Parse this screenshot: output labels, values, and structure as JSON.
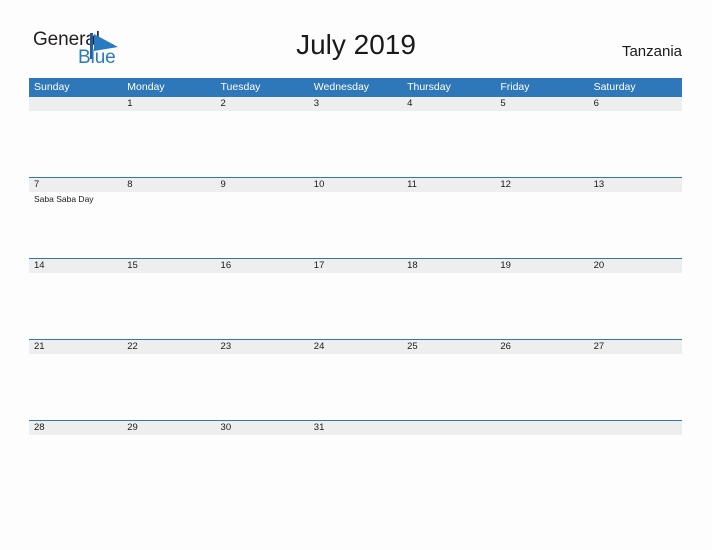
{
  "brand": {
    "name_part1": "General",
    "name_part2": "Blue",
    "mark": "flag-triangle-icon",
    "accent_color": "#2a7ac0"
  },
  "header": {
    "title": "July 2019",
    "region": "Tanzania"
  },
  "calendar": {
    "header_color": "#2e77b8",
    "band_color": "#eeeeee",
    "weekdays": [
      "Sunday",
      "Monday",
      "Tuesday",
      "Wednesday",
      "Thursday",
      "Friday",
      "Saturday"
    ],
    "weeks": [
      {
        "days": [
          {
            "date": "",
            "events": []
          },
          {
            "date": "1",
            "events": []
          },
          {
            "date": "2",
            "events": []
          },
          {
            "date": "3",
            "events": []
          },
          {
            "date": "4",
            "events": []
          },
          {
            "date": "5",
            "events": []
          },
          {
            "date": "6",
            "events": []
          }
        ]
      },
      {
        "days": [
          {
            "date": "7",
            "events": [
              "Saba Saba Day"
            ]
          },
          {
            "date": "8",
            "events": []
          },
          {
            "date": "9",
            "events": []
          },
          {
            "date": "10",
            "events": []
          },
          {
            "date": "11",
            "events": []
          },
          {
            "date": "12",
            "events": []
          },
          {
            "date": "13",
            "events": []
          }
        ]
      },
      {
        "days": [
          {
            "date": "14",
            "events": []
          },
          {
            "date": "15",
            "events": []
          },
          {
            "date": "16",
            "events": []
          },
          {
            "date": "17",
            "events": []
          },
          {
            "date": "18",
            "events": []
          },
          {
            "date": "19",
            "events": []
          },
          {
            "date": "20",
            "events": []
          }
        ]
      },
      {
        "days": [
          {
            "date": "21",
            "events": []
          },
          {
            "date": "22",
            "events": []
          },
          {
            "date": "23",
            "events": []
          },
          {
            "date": "24",
            "events": []
          },
          {
            "date": "25",
            "events": []
          },
          {
            "date": "26",
            "events": []
          },
          {
            "date": "27",
            "events": []
          }
        ]
      },
      {
        "days": [
          {
            "date": "28",
            "events": []
          },
          {
            "date": "29",
            "events": []
          },
          {
            "date": "30",
            "events": []
          },
          {
            "date": "31",
            "events": []
          },
          {
            "date": "",
            "events": []
          },
          {
            "date": "",
            "events": []
          },
          {
            "date": "",
            "events": []
          }
        ]
      }
    ]
  }
}
